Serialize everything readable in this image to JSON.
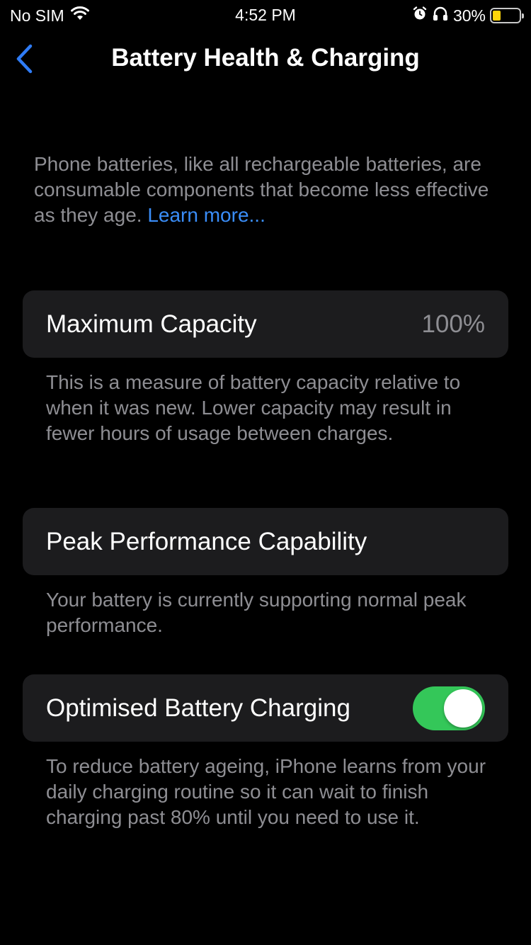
{
  "status_bar": {
    "carrier": "No SIM",
    "time": "4:52 PM",
    "battery_percent": "30%",
    "battery_level": 0.3,
    "battery_color": "#ffd60a",
    "icons": [
      "wifi-icon",
      "alarm-icon",
      "headphones-icon",
      "battery-icon"
    ]
  },
  "nav": {
    "back_icon": "chevron-left-icon",
    "title": "Battery Health & Charging",
    "accent": "#2f7cf6"
  },
  "intro": {
    "text": "Phone batteries, like all rechargeable batteries, are consumable components that become less effective as they age. ",
    "link": "Learn more..."
  },
  "max_capacity": {
    "label": "Maximum Capacity",
    "value": "100%",
    "footer": "This is a measure of battery capacity relative to when it was new. Lower capacity may result in fewer hours of usage between charges."
  },
  "peak_performance": {
    "label": "Peak Performance Capability",
    "footer": "Your battery is currently supporting normal peak performance."
  },
  "optimised_charging": {
    "label": "Optimised Battery Charging",
    "enabled": true,
    "toggle_color": "#34c759",
    "footer": "To reduce battery ageing, iPhone learns from your daily charging routine so it can wait to finish charging past 80% until you need to use it."
  }
}
